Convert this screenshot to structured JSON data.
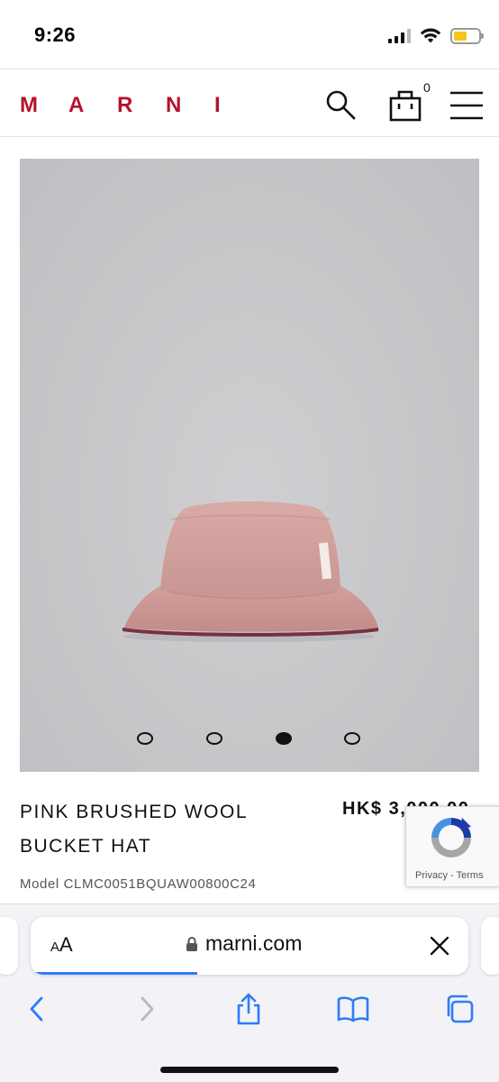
{
  "status_bar": {
    "time": "9:26",
    "battery_color": "#f5c518"
  },
  "header": {
    "logo_letters": [
      "M",
      "A",
      "R",
      "N",
      "I"
    ],
    "logo_color": "#b3122a",
    "cart_count": "0",
    "icons": [
      "search-icon",
      "shopping-bag-icon",
      "hamburger-menu-icon"
    ]
  },
  "gallery": {
    "image_subject": "pink brushed wool bucket hat",
    "slide_count": 4,
    "active_slide": 3
  },
  "product": {
    "name_line1": "PINK BRUSHED WOOL",
    "name_line2": "BUCKET HAT",
    "price": "HK$ 3,000.00",
    "model": "Model CLMC0051BQUAW00800C24"
  },
  "recaptcha": {
    "privacy": "Privacy",
    "separator": " - ",
    "terms": "Terms"
  },
  "browser": {
    "aa_small": "A",
    "aa_large": "A",
    "url": "marni.com",
    "accent": "#2f7cf6",
    "load_progress": 0.38,
    "toolbar_icons": [
      "back-icon",
      "forward-icon",
      "share-icon",
      "bookmarks-icon",
      "tabs-icon"
    ]
  }
}
